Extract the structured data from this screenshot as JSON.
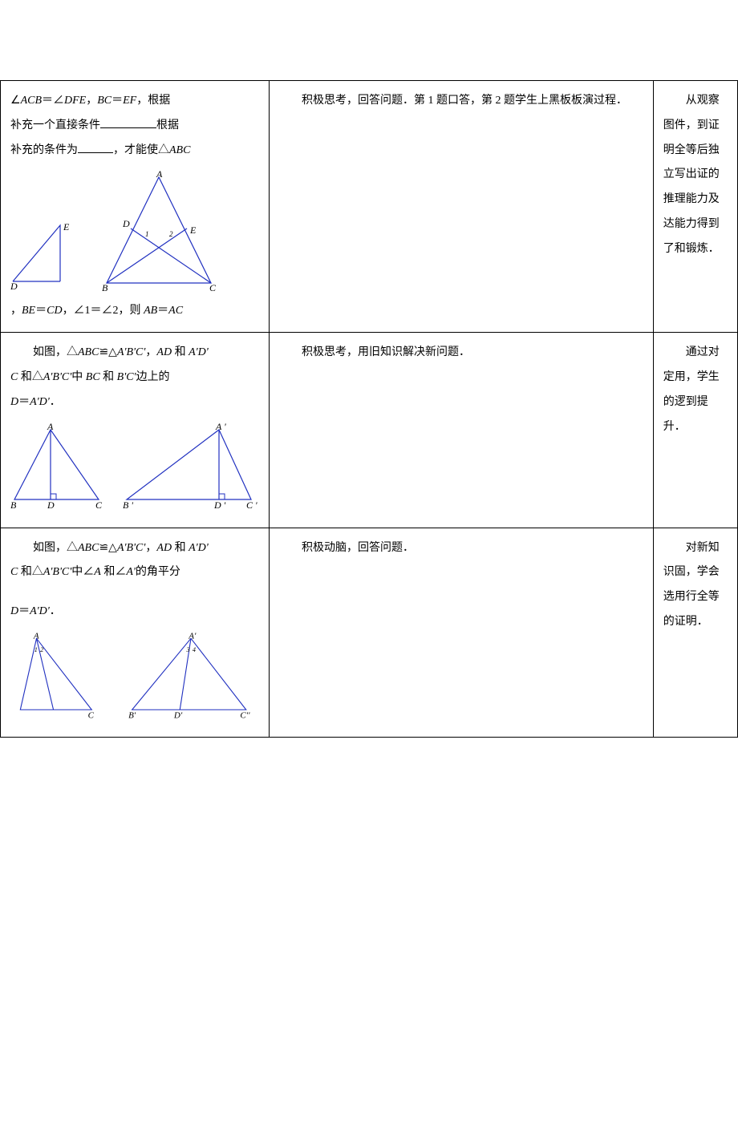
{
  "row1": {
    "line1_a": "∠",
    "line1_b": "ACB",
    "line1_c": "＝∠",
    "line1_d": "DFE",
    "line1_e": "，",
    "line1_f": "BC",
    "line1_g": "＝",
    "line1_h": "EF",
    "line1_i": "，根据",
    "line2_a": "补充一个直接条件",
    "line2_b": "根据",
    "line3_a": "补充的条件为",
    "line3_b": "，才能使△",
    "line3_c": "ABC",
    "line4_a": "，",
    "line4_b": "BE",
    "line4_c": "＝",
    "line4_d": "CD",
    "line4_e": "，∠1＝∠2，则 ",
    "line4_f": "AB",
    "line4_g": "＝",
    "line4_h": "AC",
    "mid": "积极思考，回答问题．第 1 题口答，第 2 题学生上黑板板演过程．",
    "right": "从观察图件，到证明全等后独立写出证的推理能力及达能力得到了和锻炼．"
  },
  "row2": {
    "l1a": "如图，△",
    "l1b": "ABC",
    "l1c": "≌△",
    "l1d": "A'B'C'",
    "l1e": "，",
    "l1f": "AD",
    "l1g": " 和 ",
    "l1h": "A'D'",
    "l2a": "C",
    "l2b": " 和△",
    "l2c": "A'B'C'",
    "l2d": "中 ",
    "l2e": "BC",
    "l2f": " 和 ",
    "l2g": "B'C'",
    "l2h": "边上的",
    "l3a": "D",
    "l3b": "＝",
    "l3c": "A'D'",
    "l3d": "．",
    "mid": "积极思考，用旧知识解决新问题．",
    "right": "通过对定用，学生的逻到提升．"
  },
  "row3": {
    "l1a": "如图，△",
    "l1b": "ABC",
    "l1c": "≌△",
    "l1d": "A'B'C'",
    "l1e": "，",
    "l1f": "AD",
    "l1g": " 和 ",
    "l1h": "A'D'",
    "l2a": "C",
    "l2b": " 和△",
    "l2c": "A'B'C'",
    "l2d": "中∠",
    "l2e": "A",
    "l2f": " 和∠",
    "l2g": "A'",
    "l2h": "的角平分",
    "l3a": "D",
    "l3b": "＝",
    "l3c": "A'D'",
    "l3d": "．",
    "mid": "积极动脑，回答问题．",
    "right": "对新知识固，学会选用行全等的证明．"
  }
}
